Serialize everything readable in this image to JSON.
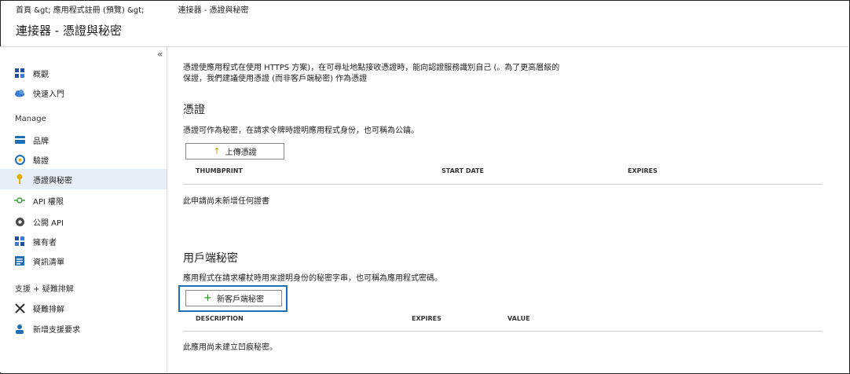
{
  "breadcrumb": [
    "首頁 &gt; 應用程式註冊 (預覽) &gt;",
    "連接器 - 憑證與秘密"
  ],
  "page_title": "連接器 - 憑證與秘密",
  "sidebar": {
    "collapse_glyph": "«",
    "items_top": [
      {
        "label": "概觀",
        "icon": "grid-icon"
      },
      {
        "label": "快速入門",
        "icon": "cloud-rocket-icon"
      }
    ],
    "manage_heading": "Manage",
    "manage_items": [
      {
        "label": "品牌",
        "icon": "card-icon"
      },
      {
        "label": "驗證",
        "icon": "refresh-icon"
      },
      {
        "label": "憑證與秘密",
        "icon": "key-icon",
        "active": true
      },
      {
        "label": "API 權限",
        "icon": "api-icon"
      },
      {
        "label": "公開 API",
        "icon": "cloud-gear-icon"
      },
      {
        "label": "擁有者",
        "icon": "people-grid-icon"
      },
      {
        "label": "資訊清單",
        "icon": "manifest-icon"
      }
    ],
    "support_heading": "支援 + 疑難排解",
    "support_items": [
      {
        "label": "疑難排解",
        "icon": "tools-icon"
      },
      {
        "label": "新增支援要求",
        "icon": "person-support-icon"
      }
    ]
  },
  "intro": "憑證使應用程式在使用 HTTPS 方案)，在可尋址地點接收憑證時，能向認證服務識別自己 (。為了更高層級的保證，我們建議使用憑證 (而非客戶端秘密) 作為憑證",
  "certificates": {
    "heading": "憑證",
    "description": "憑證可作為秘密，在請求令牌時證明應用程式身份，也可稱為公鑰。",
    "upload_button": "上傳憑證",
    "columns": [
      "THUMBPRINT",
      "START DATE",
      "EXPIRES"
    ],
    "empty_text": "此申請尚未新增任何證書"
  },
  "client_secrets": {
    "heading": "用戶端秘密",
    "description": "應用程式在請求權杖時用來證明身份的秘密字串，也可稱為應用程式密碼。",
    "new_button": "新客戶端秘密",
    "columns": [
      "DESCRIPTION",
      "EXPIRES",
      "VALUE"
    ],
    "empty_text": "此應用尚未建立凹痕秘密。"
  },
  "colors": {
    "accent": "#1f6fb5",
    "active_bg": "#e6eef7",
    "plus": "#2a8a2a"
  }
}
